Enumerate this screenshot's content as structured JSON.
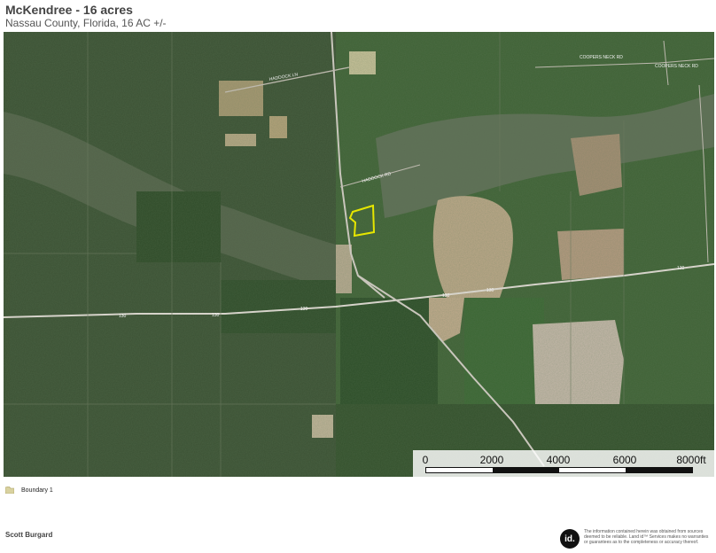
{
  "header": {
    "title": "McKendree - 16 acres",
    "subtitle": "Nassau County, Florida, 16 AC +/-"
  },
  "map": {
    "road_labels": [
      "HADDOCK LN",
      "HADDOCK RD",
      "COOPERS NECK RD",
      "COOPERS NECK RD",
      "130",
      "130",
      "130",
      "130",
      "130",
      "130"
    ],
    "boundary_color": "#e6e600"
  },
  "scale": {
    "labels": [
      "0",
      "2000",
      "4000",
      "6000",
      "8000ft"
    ]
  },
  "legend": {
    "items": [
      {
        "label": "Boundary 1",
        "color": "#d9d2a0"
      }
    ]
  },
  "footer": {
    "author": "Scott Burgard",
    "logo_text": "id.",
    "disclaimer": "The information contained herein was obtained from sources deemed to be reliable. Land id™ Services makes no warranties or guarantees as to the completeness or accuracy thereof."
  }
}
